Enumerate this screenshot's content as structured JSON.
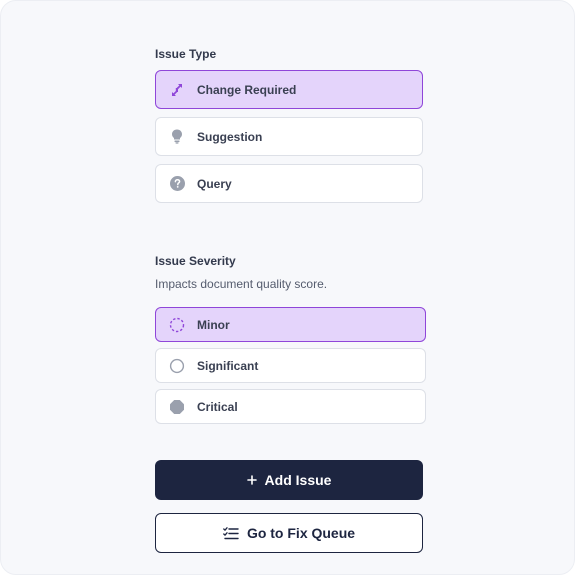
{
  "issue_type": {
    "title": "Issue Type",
    "options": [
      {
        "label": "Change Required",
        "icon": "swap-arrows-icon",
        "selected": true
      },
      {
        "label": "Suggestion",
        "icon": "lightbulb-icon",
        "selected": false
      },
      {
        "label": "Query",
        "icon": "question-circle-icon",
        "selected": false
      }
    ]
  },
  "issue_severity": {
    "title": "Issue Severity",
    "subtitle": "Impacts document quality score.",
    "options": [
      {
        "label": "Minor",
        "icon": "dashed-circle-icon",
        "selected": true
      },
      {
        "label": "Significant",
        "icon": "outline-circle-icon",
        "selected": false
      },
      {
        "label": "Critical",
        "icon": "filled-octagon-icon",
        "selected": false
      }
    ]
  },
  "actions": {
    "add_issue_label": "Add Issue",
    "add_issue_icon": "plus-icon",
    "fix_queue_label": "Go to Fix Queue",
    "fix_queue_icon": "checklist-icon"
  },
  "colors": {
    "accent": "#8f46d9",
    "selected_bg": "#e4d4fb",
    "primary_button": "#1d2540",
    "icon_gray": "#9aa0ad"
  }
}
